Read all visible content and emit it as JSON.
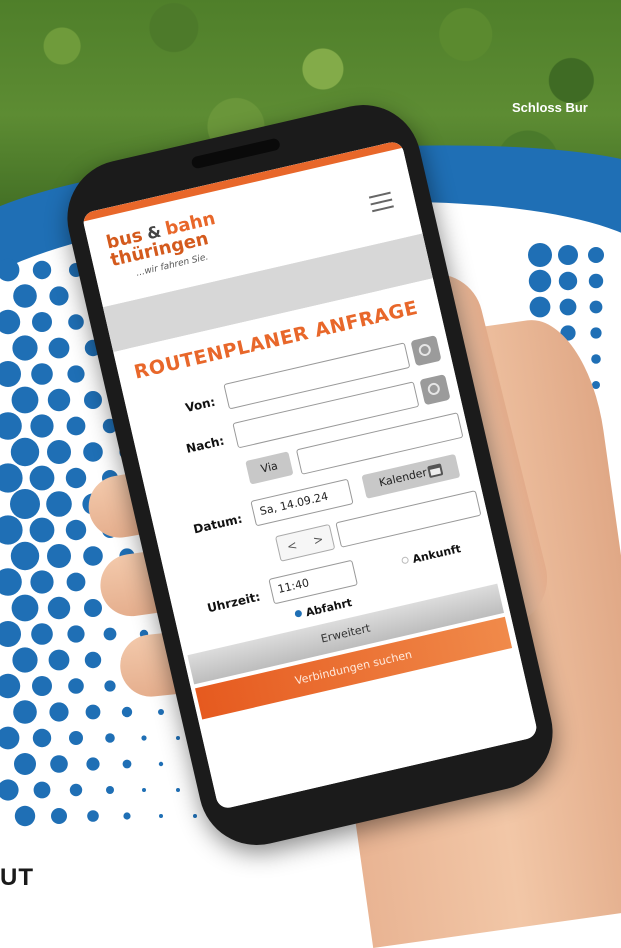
{
  "caption": "Schloss Bur",
  "corner_text": "UT",
  "app": {
    "logo": {
      "bus": "bus",
      "amp": "&",
      "bahn": "bahn",
      "thueringen": "thüringen",
      "slogan": "...wir fahren Sie."
    },
    "title": "ROUTENPLANER ANFRAGE",
    "from_label": "Von:",
    "from_value": "",
    "to_label": "Nach:",
    "to_value": "",
    "via_label": "Via",
    "date_label": "Datum:",
    "date_value": "Sa, 14.09.24",
    "calendar_label": "Kalender",
    "prev_glyph": "<",
    "next_glyph": ">",
    "time_label": "Uhrzeit:",
    "time_value": "11:40",
    "departure_label": "Abfahrt",
    "arrival_label": "Ankunft",
    "selected": "Abfahrt",
    "advanced_label": "Erweitert",
    "search_label": "Verbindungen suchen"
  },
  "colors": {
    "accent": "#e8672a",
    "blue": "#1f6fb5",
    "forest": "#4f7f2a"
  },
  "icons": [
    "menu-icon",
    "location-icon",
    "calendar-icon",
    "chevron-left-icon",
    "chevron-right-icon"
  ]
}
